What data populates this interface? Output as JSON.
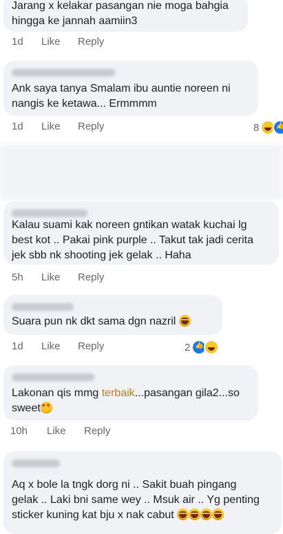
{
  "comments": [
    {
      "lines": [
        "Jarang x kelakar pasangan nie moga bahgia",
        "hingga ke jannah aamiin3"
      ],
      "time": "1d",
      "like": "Like",
      "reply": "Reply",
      "reactions": ""
    },
    {
      "lines": [
        "Ank saya tanya Smalam ibu auntie noreen ni",
        "nangis ke ketawa... Ermmmm"
      ],
      "time": "1d",
      "like": "Like",
      "reply": "Reply",
      "reactions": "8"
    },
    {
      "lines": [
        "Kalau suami kak noreen gntikan watak kuchai lg",
        "best kot .. Pakai pink purple .. Takut tak jadi cerita",
        "jek sbb nk shooting jek gelak .. Haha"
      ],
      "time": "5h",
      "like": "Like",
      "reply": "Reply",
      "reactions": ""
    },
    {
      "lines": [
        "Suara pun nk dkt sama dgn nazril"
      ],
      "time": "1d",
      "like": "Like",
      "reply": "Reply",
      "reactions": "2"
    },
    {
      "line1_pre": "Lakonan qis mmg ",
      "line1_hl": "terbaik",
      "line1_post": "...pasangan gila2...so",
      "line2": "sweet",
      "time": "10h",
      "like": "Like",
      "reply": "Reply"
    },
    {
      "lines": [
        "Aq x bole la tngk dorg ni .. Sakit buah pingang",
        "gelak .. Laki bni same wey .. Msuk air .. Yg penting",
        "sticker kuning kat bju x nak cabut"
      ]
    }
  ],
  "icons": {
    "laugh_emoji": "laughing-emoji",
    "heart_eyes_emoji": "heart-eyes-emoji",
    "like_reaction": "like-reaction-icon",
    "haha_reaction": "haha-reaction-icon"
  },
  "colors": {
    "bubble": "#f0f2f5",
    "text": "#1c1e21",
    "meta": "#65676b",
    "highlight": "#c07b17",
    "like_blue": "#1877f2"
  }
}
